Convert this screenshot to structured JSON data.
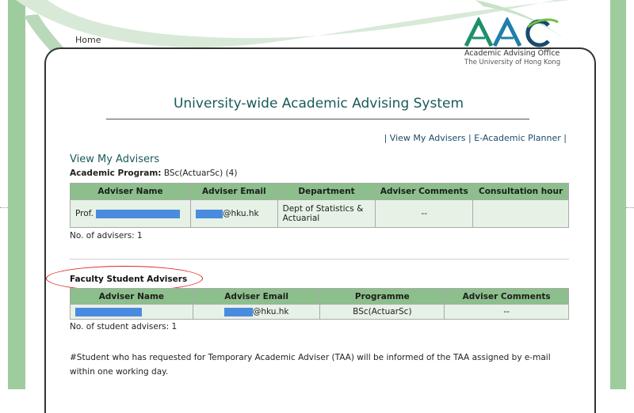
{
  "header": {
    "home_link": "Home",
    "logo_mark": "AAO",
    "logo_line1": "Academic Advising Office",
    "logo_line2": "The University of Hong Kong"
  },
  "page_title": "University-wide Academic Advising System",
  "top_links": {
    "left_bar": "|",
    "view_advisers": "View My Advisers",
    "mid_bar": "|",
    "planner": "E-Academic Planner",
    "right_bar": "|"
  },
  "section": {
    "title": "View My Advisers",
    "program_label": "Academic Program:",
    "program_value": "BSc(ActuarSc) (4)"
  },
  "advisers_table": {
    "columns": [
      "Adviser Name",
      "Adviser Email",
      "Department",
      "Adviser Comments",
      "Consultation hour"
    ],
    "rows": [
      {
        "name_prefix": "Prof.",
        "email_suffix": "@hku.hk",
        "department": "Dept of Statistics & Actuarial",
        "comments": "--",
        "hour": ""
      }
    ]
  },
  "advisers_count": "No. of advisers: 1",
  "faculty": {
    "heading": "Faculty Student Advisers",
    "columns": [
      "Adviser Name",
      "Adviser Email",
      "Programme",
      "Adviser Comments"
    ],
    "rows": [
      {
        "email_suffix": "@hku.hk",
        "programme": "BSc(ActuarSc)",
        "comments": "--"
      }
    ],
    "count": "No. of student advisers: 1"
  },
  "note": "#Student who has requested for Temporary Academic Adviser (TAA) will be informed of the TAA assigned by e-mail within one working day.",
  "colors": {
    "header_green": "#8cbf8c",
    "row_green": "#e6f2e6",
    "title_teal": "#1a5a5a",
    "redaction": "#4a8be0",
    "annotation_red": "#dd2222"
  }
}
